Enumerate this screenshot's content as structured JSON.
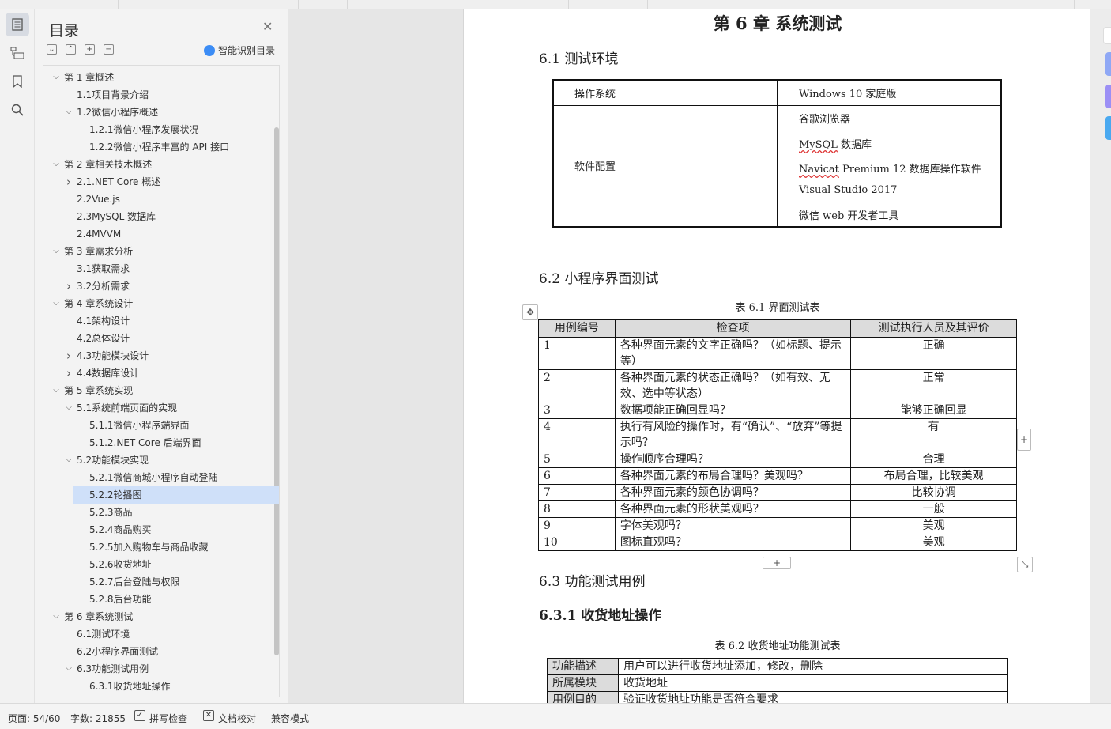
{
  "sidebar": {
    "title": "目录",
    "smart_label": "智能识别目录",
    "toc": [
      {
        "label": "第 1 章概述",
        "level": 1,
        "caret": "down"
      },
      {
        "label": "1.1项目背景介绍",
        "level": 2,
        "caret": ""
      },
      {
        "label": "1.2微信小程序概述",
        "level": 2,
        "caret": "down"
      },
      {
        "label": "1.2.1微信小程序发展状况",
        "level": 3,
        "caret": ""
      },
      {
        "label": "1.2.2微信小程序丰富的 API 接口",
        "level": 3,
        "caret": ""
      },
      {
        "label": "第 2 章相关技术概述",
        "level": 1,
        "caret": "down"
      },
      {
        "label": "2.1.NET Core 概述",
        "level": 2,
        "caret": "right"
      },
      {
        "label": "2.2Vue.js",
        "level": 2,
        "caret": ""
      },
      {
        "label": "2.3MySQL 数据库",
        "level": 2,
        "caret": ""
      },
      {
        "label": "2.4MVVM",
        "level": 2,
        "caret": ""
      },
      {
        "label": "第 3 章需求分析",
        "level": 1,
        "caret": "down"
      },
      {
        "label": "3.1获取需求",
        "level": 2,
        "caret": ""
      },
      {
        "label": "3.2分析需求",
        "level": 2,
        "caret": "right"
      },
      {
        "label": "第 4 章系统设计",
        "level": 1,
        "caret": "down"
      },
      {
        "label": "4.1架构设计",
        "level": 2,
        "caret": ""
      },
      {
        "label": "4.2总体设计",
        "level": 2,
        "caret": ""
      },
      {
        "label": "4.3功能模块设计",
        "level": 2,
        "caret": "right"
      },
      {
        "label": "4.4数据库设计",
        "level": 2,
        "caret": "right"
      },
      {
        "label": "第 5 章系统实现",
        "level": 1,
        "caret": "down"
      },
      {
        "label": "5.1系统前端页面的实现",
        "level": 2,
        "caret": "down"
      },
      {
        "label": "5.1.1微信小程序端界面",
        "level": 3,
        "caret": ""
      },
      {
        "label": "5.1.2.NET Core 后端界面",
        "level": 3,
        "caret": ""
      },
      {
        "label": "5.2功能模块实现",
        "level": 2,
        "caret": "down"
      },
      {
        "label": "5.2.1微信商城小程序自动登陆",
        "level": 3,
        "caret": ""
      },
      {
        "label": "5.2.2轮播图",
        "level": 3,
        "caret": "",
        "selected": true
      },
      {
        "label": "5.2.3商品",
        "level": 3,
        "caret": ""
      },
      {
        "label": "5.2.4商品购买",
        "level": 3,
        "caret": ""
      },
      {
        "label": "5.2.5加入购物车与商品收藏",
        "level": 3,
        "caret": ""
      },
      {
        "label": "5.2.6收货地址",
        "level": 3,
        "caret": ""
      },
      {
        "label": "5.2.7后台登陆与权限",
        "level": 3,
        "caret": ""
      },
      {
        "label": "5.2.8后台功能",
        "level": 3,
        "caret": ""
      },
      {
        "label": "第 6 章系统测试",
        "level": 1,
        "caret": "down"
      },
      {
        "label": "6.1测试环境",
        "level": 2,
        "caret": ""
      },
      {
        "label": "6.2小程序界面测试",
        "level": 2,
        "caret": ""
      },
      {
        "label": "6.3功能测试用例",
        "level": 2,
        "caret": "down"
      },
      {
        "label": "6.3.1收货地址操作",
        "level": 3,
        "caret": ""
      }
    ]
  },
  "doc": {
    "chapter": "第 6 章  系统测试",
    "s61": "6.1  测试环境",
    "env": {
      "os_key": "操作系统",
      "os_val": "Windows 10 家庭版",
      "sw_key": "软件配置",
      "sw_1": "谷歌浏览器",
      "sw_2a": "MySQL",
      "sw_2b": " 数据库",
      "sw_3a": "Navicat",
      "sw_3b": " Premium 12 数据库操作软件",
      "sw_4": "Visual Studio 2017",
      "sw_5": "微信 web 开发者工具"
    },
    "s62": "6.2  小程序界面测试",
    "t1_caption": "表  6.1 界面测试表",
    "t1_headers": [
      "用例编号",
      "检查项",
      "测试执行人员及其评价"
    ],
    "t1_rows": [
      [
        "1",
        "各种界面元素的文字正确吗？（如标题、提示等）",
        "正确"
      ],
      [
        "2",
        "各种界面元素的状态正确吗？（如有效、无效、选中等状态）",
        "正常"
      ],
      [
        "3",
        "数据项能正确回显吗？",
        "能够正确回显"
      ],
      [
        "4",
        "执行有风险的操作时，有“确认”、“放弃”等提示吗？",
        "有"
      ],
      [
        "5",
        "操作顺序合理吗？",
        "合理"
      ],
      [
        "6",
        "各种界面元素的布局合理吗？美观吗？",
        "布局合理，比较美观"
      ],
      [
        "7",
        "各种界面元素的颜色协调吗？",
        "比较协调"
      ],
      [
        "8",
        "各种界面元素的形状美观吗？",
        "一般"
      ],
      [
        "9",
        "字体美观吗？",
        "美观"
      ],
      [
        "10",
        "图标直观吗？",
        "美观"
      ]
    ],
    "s63": "6.3  功能测试用例",
    "s631": "6.3.1  收货地址操作",
    "t2_caption": "表  6.2 收货地址功能测试表",
    "t2_rows": [
      [
        "功能描述",
        "用户可以进行收货地址添加，修改，删除"
      ],
      [
        "所属模块",
        "收货地址"
      ],
      [
        "用例目的",
        "验证收货地址功能是否符合要求"
      ]
    ]
  },
  "status": {
    "page": "页面: 54/60",
    "words": "字数: 21855",
    "spell": "拼写检查",
    "proof": "文档校对",
    "compat": "兼容模式"
  },
  "colors": {
    "selected": "#cfe0f9",
    "accent": "#3b8cf5"
  }
}
